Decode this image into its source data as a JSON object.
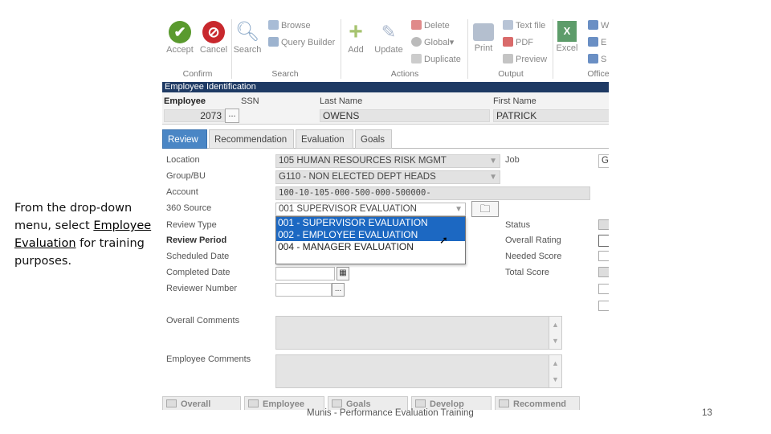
{
  "slide": {
    "instruction_prefix": "From the drop-down menu, select ",
    "instruction_emph": "Employee Evaluation",
    "instruction_suffix": " for training purposes.",
    "footer_title": "Munis - Performance Evaluation Training",
    "page_number": "13"
  },
  "ribbon": {
    "accept": "Accept",
    "cancel": "Cancel",
    "search": "Search",
    "browse": "Browse",
    "query_builder": "Query Builder",
    "add": "Add",
    "update": "Update",
    "delete": "Delete",
    "global": "Global",
    "duplicate": "Duplicate",
    "print": "Print",
    "text_file": "Text file",
    "pdf": "PDF",
    "preview": "Preview",
    "excel": "Excel",
    "office_w": "W",
    "office_e": "E",
    "office_s": "S",
    "groups": {
      "confirm": "Confirm",
      "search": "Search",
      "actions": "Actions",
      "output": "Output",
      "office": "Office"
    }
  },
  "window_title": "Employee Identification",
  "employee_id": {
    "employee_label": "Employee",
    "ssn_label": "SSN",
    "last_name_label": "Last Name",
    "first_name_label": "First Name",
    "employee_number": "2073",
    "dots": "...",
    "last_name": "OWENS",
    "first_name": "PATRICK"
  },
  "tabs": [
    "Review",
    "Recommendation",
    "Evaluation",
    "Goals"
  ],
  "form": {
    "location_label": "Location",
    "location_value": "105   HUMAN RESOURCES RISK MGMT",
    "job_label": "Job",
    "job_value": "G",
    "group_label": "Group/BU",
    "group_value": "G110 - NON ELECTED DEPT HEADS",
    "account_label": "Account",
    "account_value": "100-10-105-000-500-000-500000-",
    "source_label": "360 Source",
    "source_value": "001   SUPERVISOR EVALUATION",
    "review_type_label": "Review Type",
    "review_period_label": "Review Period",
    "scheduled_date_label": "Scheduled Date",
    "completed_date_label": "Completed Date",
    "reviewer_number_label": "Reviewer Number",
    "status_label": "Status",
    "overall_rating_label": "Overall Rating",
    "needed_score_label": "Needed Score",
    "total_score_label": "Total Score",
    "overall_comments_label": "Overall Comments",
    "employee_comments_label": "Employee Comments",
    "dots": "..."
  },
  "dropdown_options": [
    "001 - SUPERVISOR EVALUATION",
    "002 - EMPLOYEE EVALUATION",
    "004 - MANAGER EVALUATION"
  ],
  "bottom_buttons": [
    "Overall",
    "Employee",
    "Goals",
    "Develop",
    "Recommend"
  ],
  "colors": {
    "title_bar": "#1e3a64",
    "active_tab": "#4a86c5",
    "selected_option": "#1c68c2",
    "accept": "#5a9a2e",
    "cancel": "#c8282d"
  }
}
